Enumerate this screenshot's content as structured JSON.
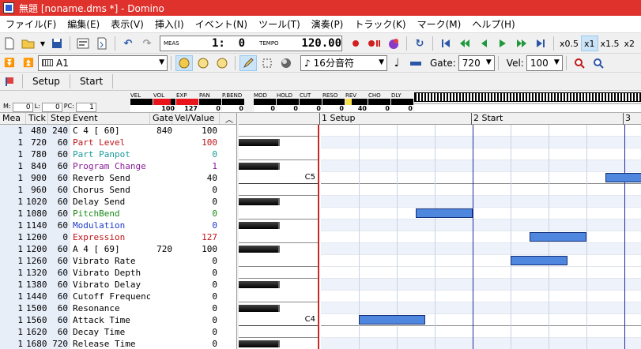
{
  "window": {
    "title": "無題 [noname.dms *] - Domino"
  },
  "menu": [
    "ファイル(F)",
    "編集(E)",
    "表示(V)",
    "挿入(I)",
    "イベント(N)",
    "ツール(T)",
    "演奏(P)",
    "トラック(K)",
    "マーク(M)",
    "ヘルプ(H)"
  ],
  "transport": {
    "meas_label": "MEAS",
    "meas_value": "1:  0",
    "tempo_label": "TEMPO",
    "tempo_value": "120.00"
  },
  "speeds": [
    "x0.5",
    "x1",
    "x1.5",
    "x2"
  ],
  "selected_speed": "x1",
  "track": {
    "name": "A1",
    "quantize": "16分音符",
    "gate_label": "Gate:",
    "gate": "720",
    "vel_label": "Vel:",
    "vel": "100"
  },
  "markers": [
    "Setup",
    "Start"
  ],
  "position": {
    "m_label": "M:",
    "m": "0",
    "l_label": "L:",
    "l": "0",
    "pc_label": "PC:",
    "pc": "1"
  },
  "meters": [
    {
      "label": "VEL",
      "value": "",
      "fill": 0
    },
    {
      "label": "VOL",
      "value": "100",
      "fill": 0.78
    },
    {
      "label": "EXP",
      "value": "127",
      "fill": 1.0
    },
    {
      "label": "PAN",
      "value": "0",
      "fill": 0
    },
    {
      "label": "P.BEND",
      "value": "0",
      "fill": 0
    },
    {
      "label": "MOD",
      "value": "0",
      "fill": 0
    },
    {
      "label": "HOLD",
      "value": "0",
      "fill": 0
    },
    {
      "label": "CUT",
      "value": "0",
      "fill": 0
    },
    {
      "label": "RESO",
      "value": "0",
      "fill": 0
    },
    {
      "label": "REV",
      "value": "40",
      "fill": 0.3
    },
    {
      "label": "CHO",
      "value": "0",
      "fill": 0
    },
    {
      "label": "DLY",
      "value": "0",
      "fill": 0
    }
  ],
  "event_headers": {
    "mea": "Mea",
    "tick": "Tick",
    "step": "Step",
    "event": "Event",
    "gate": "Gate",
    "vel": "Vel/Value"
  },
  "events": [
    {
      "mea": "1",
      "tick": "480",
      "step": "240",
      "event": "C  4 [ 60]",
      "gate": "840",
      "value": "100",
      "color": "#000000"
    },
    {
      "mea": "1",
      "tick": "720",
      "step": "60",
      "event": "Part Level",
      "gate": "",
      "value": "100",
      "color": "#c0141a"
    },
    {
      "mea": "1",
      "tick": "780",
      "step": "60",
      "event": "Part Panpot",
      "gate": "",
      "value": "0",
      "color": "#1a9a9a"
    },
    {
      "mea": "1",
      "tick": "840",
      "step": "60",
      "event": "Program Change",
      "gate": "",
      "value": "1",
      "color": "#8a1a9a"
    },
    {
      "mea": "1",
      "tick": "900",
      "step": "60",
      "event": "Reverb Send",
      "gate": "",
      "value": "40",
      "color": "#000000"
    },
    {
      "mea": "1",
      "tick": "960",
      "step": "60",
      "event": "Chorus Send",
      "gate": "",
      "value": "0",
      "color": "#000000"
    },
    {
      "mea": "1",
      "tick": "1020",
      "step": "60",
      "event": "Delay Send",
      "gate": "",
      "value": "0",
      "color": "#000000"
    },
    {
      "mea": "1",
      "tick": "1080",
      "step": "60",
      "event": "PitchBend",
      "gate": "",
      "value": "0",
      "color": "#1a8a1a"
    },
    {
      "mea": "1",
      "tick": "1140",
      "step": "60",
      "event": "Modulation",
      "gate": "",
      "value": "0",
      "color": "#1a3acc"
    },
    {
      "mea": "1",
      "tick": "1200",
      "step": "0",
      "event": "Expression",
      "gate": "",
      "value": "127",
      "color": "#c0141a"
    },
    {
      "mea": "1",
      "tick": "1200",
      "step": "60",
      "event": "A  4 [ 69]",
      "gate": "720",
      "value": "100",
      "color": "#000000"
    },
    {
      "mea": "1",
      "tick": "1260",
      "step": "60",
      "event": "Vibrato Rate",
      "gate": "",
      "value": "0",
      "color": "#000000"
    },
    {
      "mea": "1",
      "tick": "1320",
      "step": "60",
      "event": "Vibrato Depth",
      "gate": "",
      "value": "0",
      "color": "#000000"
    },
    {
      "mea": "1",
      "tick": "1380",
      "step": "60",
      "event": "Vibrato Delay",
      "gate": "",
      "value": "0",
      "color": "#000000"
    },
    {
      "mea": "1",
      "tick": "1440",
      "step": "60",
      "event": "Cutoff Frequency",
      "gate": "",
      "value": "0",
      "color": "#000000"
    },
    {
      "mea": "1",
      "tick": "1500",
      "step": "60",
      "event": "Resonance",
      "gate": "",
      "value": "0",
      "color": "#000000"
    },
    {
      "mea": "1",
      "tick": "1560",
      "step": "60",
      "event": "Attack Time",
      "gate": "",
      "value": "0",
      "color": "#000000"
    },
    {
      "mea": "1",
      "tick": "1620",
      "step": "60",
      "event": "Decay Time",
      "gate": "",
      "value": "0",
      "color": "#000000"
    },
    {
      "mea": "1",
      "tick": "1680",
      "step": "720",
      "event": "Release Time",
      "gate": "",
      "value": "0",
      "color": "#000000"
    }
  ],
  "ruler": [
    {
      "label": "1 Setup",
      "measure": 1
    },
    {
      "label": "2 Start",
      "measure": 2
    },
    {
      "label": "3",
      "measure": 3
    }
  ],
  "key_labels": [
    "C5",
    "C4"
  ],
  "notes": [
    {
      "pitch": 60,
      "start_tick": 480,
      "gate": 840
    },
    {
      "pitch": 69,
      "start_tick": 1200,
      "gate": 720
    },
    {
      "pitch": 65,
      "start_tick": 2400,
      "gate": 720
    },
    {
      "pitch": 67,
      "start_tick": 2640,
      "gate": 720
    },
    {
      "pitch": 72,
      "start_tick": 3600,
      "gate": 480
    }
  ],
  "colors": {
    "titlebar": "#e0322d",
    "note": "#4f86de",
    "note_border": "#14307a",
    "bar_line": "#2727a0"
  }
}
